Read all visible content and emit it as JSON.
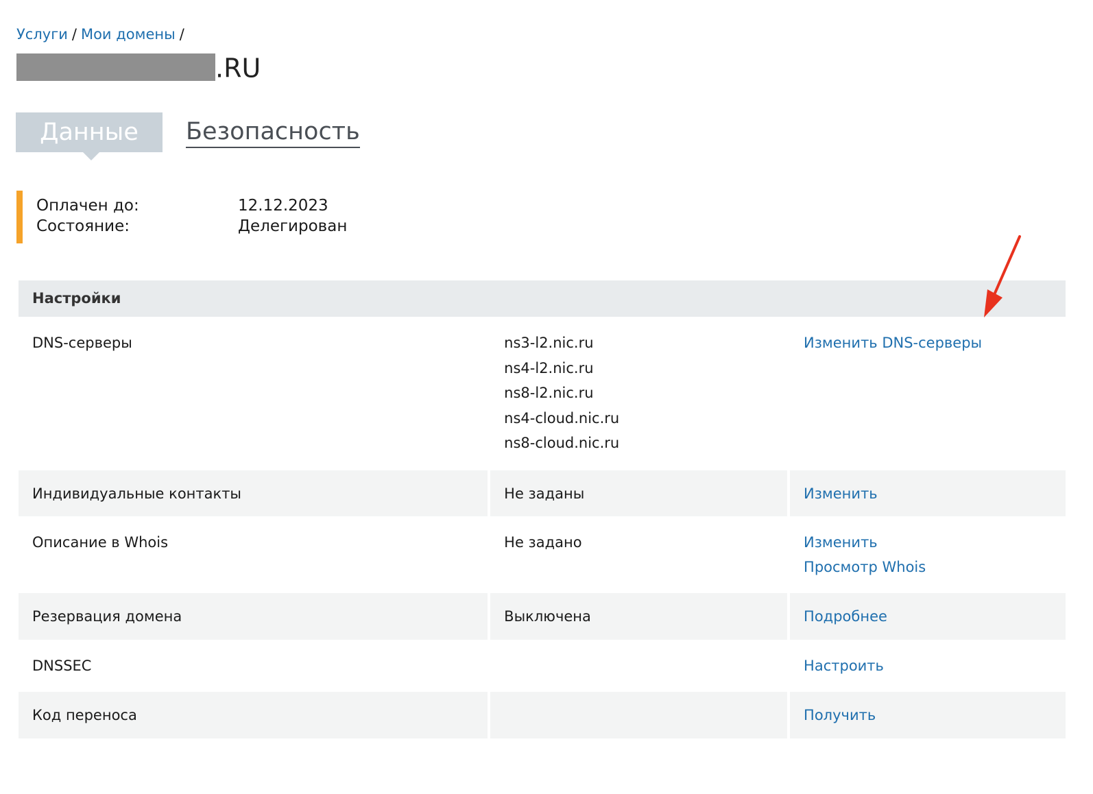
{
  "breadcrumb": {
    "items": [
      {
        "label": "Услуги"
      },
      {
        "label": "Мои домены"
      }
    ],
    "separator": "/"
  },
  "domain": {
    "tld": ".RU"
  },
  "tabs": [
    {
      "label": "Данные",
      "active": true
    },
    {
      "label": "Безопасность",
      "active": false
    }
  ],
  "status": {
    "paid_until_label": "Оплачен до:",
    "paid_until_value": "12.12.2023",
    "state_label": "Состояние:",
    "state_value": "Делегирован",
    "accent_color": "#f5a32a"
  },
  "settings": {
    "header": "Настройки",
    "rows": [
      {
        "name": "DNS-серверы",
        "values": [
          "ns3-l2.nic.ru",
          "ns4-l2.nic.ru",
          "ns8-l2.nic.ru",
          "ns4-cloud.nic.ru",
          "ns8-cloud.nic.ru"
        ],
        "actions": [
          "Изменить DNS-серверы"
        ]
      },
      {
        "name": "Индивидуальные контакты",
        "values": [
          "Не заданы"
        ],
        "actions": [
          "Изменить"
        ]
      },
      {
        "name": "Описание в Whois",
        "values": [
          "Не задано"
        ],
        "actions": [
          "Изменить",
          "Просмотр Whois"
        ]
      },
      {
        "name": "Резервация домена",
        "values": [
          "Выключена"
        ],
        "actions": [
          "Подробнее"
        ]
      },
      {
        "name": "DNSSEC",
        "values": [],
        "actions": [
          "Настроить"
        ]
      },
      {
        "name": "Код переноса",
        "values": [],
        "actions": [
          "Получить"
        ]
      }
    ]
  },
  "colors": {
    "link": "#1f6fae",
    "annotation_arrow": "#e8321e",
    "header_bg": "#e8ebed",
    "active_tab_bg": "#c9d2d9"
  }
}
